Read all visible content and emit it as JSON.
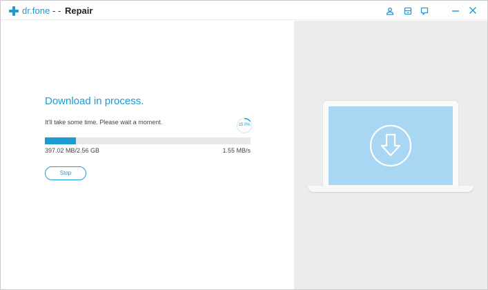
{
  "titlebar": {
    "brand": "dr.fone",
    "separator": "- -",
    "module": "Repair",
    "icons": [
      "user-icon",
      "feedback-icon",
      "chat-icon",
      "minimize-icon",
      "close-icon"
    ]
  },
  "download": {
    "heading": "Download in process.",
    "message": "It'll take some time. Please wait a moment.",
    "percent_label": "15.0%",
    "progress_fraction": 0.15,
    "downloaded": "397.02 MB/2.56 GB",
    "speed": "1.55 MB/s",
    "stop_label": "Stop"
  },
  "illustration": {
    "icon": "download-icon"
  },
  "colors": {
    "accent": "#1b9ad6",
    "panel_bg": "#ececec",
    "screen": "#a9d6f3",
    "track": "#e8e8e8"
  }
}
